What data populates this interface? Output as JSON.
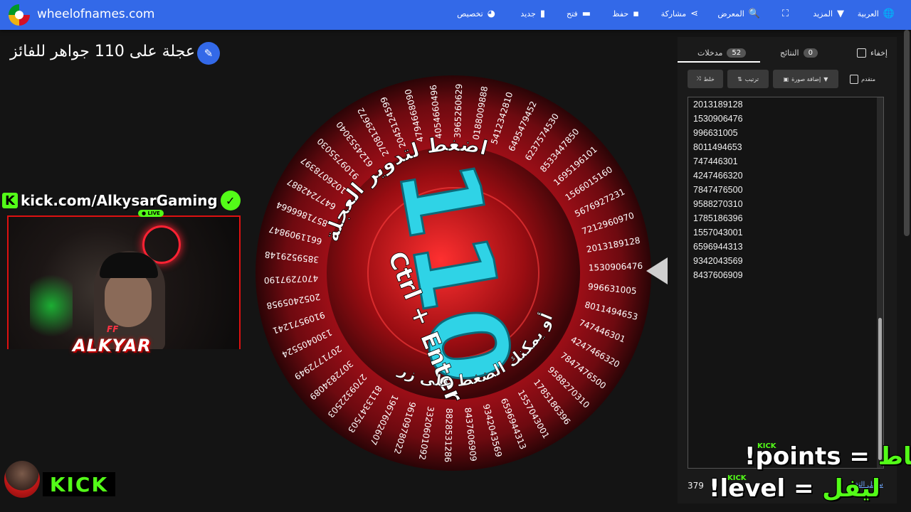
{
  "topbar": {
    "site_name": "wheelofnames.com",
    "nav": [
      {
        "label": "العربية",
        "icon": "globe-icon"
      },
      {
        "label": "المزيد",
        "icon": "caret-down-icon"
      },
      {
        "label": "",
        "icon": "fullscreen-icon"
      },
      {
        "label": "المعرض",
        "icon": "search-icon"
      },
      {
        "label": "مشاركة",
        "icon": "share-icon"
      },
      {
        "label": "حفظ",
        "icon": "save-icon"
      },
      {
        "label": "فتح",
        "icon": "folder-open-icon"
      },
      {
        "label": "جديد",
        "icon": "new-file-icon"
      },
      {
        "label": "تخصيص",
        "icon": "palette-icon"
      }
    ]
  },
  "wheel": {
    "title": "عجلة على 110 جواهر للفائز",
    "center_overlay": "110",
    "spin_text_top": "اضغط لتدوير العجلة",
    "spin_text_bottom": "أو يمكنك الضغط على زر",
    "spin_shortcut": "Ctrl + Enter",
    "visible_slices": [
      "2013189128",
      "1530906476",
      "996631005",
      "8011494653",
      "747446301",
      "4247466320",
      "7847476500",
      "9588270310",
      "1785186396",
      "1557043001",
      "6596944313",
      "9342043569",
      "8437606909",
      "8828531286",
      "3320601092",
      "9610978022",
      "1967602607",
      "8113347503",
      "2709322503",
      "3072834089",
      "2071772949",
      "1300405524",
      "9109571241",
      "2052405958",
      "4707297190",
      "3859529148",
      "6611909847",
      "8571866664",
      "6477242887",
      "1026078397",
      "9109755030",
      "6124553040",
      "2708129672",
      "2045124599",
      "4794668090",
      "4054660496",
      "3965260629",
      "0188009888",
      "5412342810",
      "6495479452",
      "6237574530",
      "8533447850",
      "1695196101",
      "1566015160",
      "5676927231",
      "7212960970"
    ]
  },
  "streamer": {
    "kick_url": "kick.com/AlkysarGaming",
    "live_label": "LIVE",
    "name": "ALKYAR",
    "tag": "FF",
    "kick_logo": "KICK"
  },
  "panel": {
    "tabs": [
      {
        "label": "مدخلات",
        "count": "52"
      },
      {
        "label": "النتائج",
        "count": "0"
      }
    ],
    "hide_label": "إخفاء",
    "toolbar": {
      "shuffle_label": "خلط",
      "sort_label": "ترتيب",
      "add_image_label": "إضافة صورة",
      "advanced_label": "متقدم"
    },
    "entries": [
      "2013189128",
      "1530906476",
      "996631005",
      "8011494653",
      "747446301",
      "4247466320",
      "7847476500",
      "9588270310",
      "1785186396",
      "1557043001",
      "6596944313",
      "9342043569",
      "8437606909"
    ],
    "bottom_count": "379",
    "bottom_link": "سجل التغيير"
  },
  "overlay": {
    "points_ar": "نقاط",
    "points_cmd": "!points",
    "level_ar": "ليفل",
    "level_cmd": "!level",
    "equals": "=",
    "kick_small": "KICK"
  },
  "colors": {
    "topbar": "#3369e8",
    "kick_green": "#53fc18",
    "wheel_red": "#c0101a",
    "overlay_cyan": "#2fd3e6"
  }
}
